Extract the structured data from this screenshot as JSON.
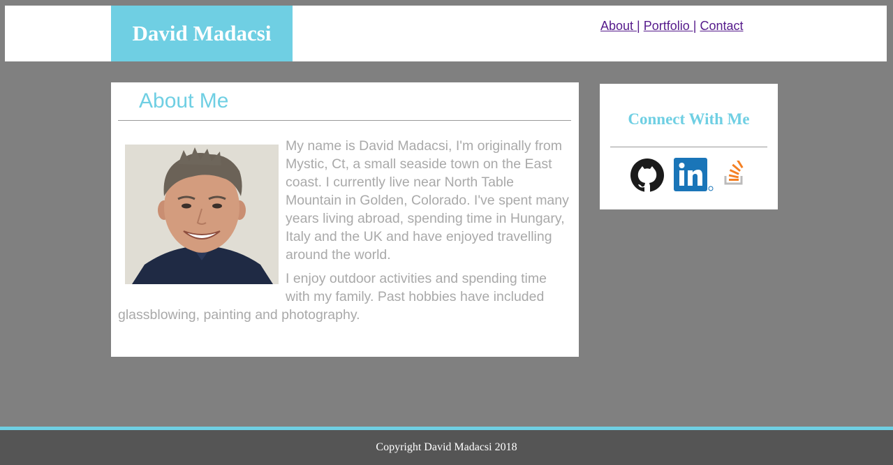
{
  "header": {
    "brand": "David Madacsi",
    "brand_color": "#6fcfe3",
    "nav": [
      {
        "label": "About |"
      },
      {
        "label": "Portfolio |"
      },
      {
        "label": "Contact"
      }
    ]
  },
  "about": {
    "title": "About Me",
    "photo_alt": "portrait-photo",
    "paragraphs": [
      "My name is David Madacsi, I'm originally from Mystic, Ct, a small seaside town on the East coast. I currently live near North Table Mountain in Golden, Colorado. I've spent many years living abroad, spending time in Hungary, Italy and the UK and have enjoyed travelling around the world.",
      "I enjoy outdoor activities and spending time with my family. Past hobbies have included glassblowing, painting and photography."
    ]
  },
  "connect": {
    "title": "Connect With Me",
    "icons": [
      "github-icon",
      "linkedin-icon",
      "stackoverflow-icon"
    ]
  },
  "footer": {
    "copyright": "Copyright David Madacsi 2018"
  },
  "colors": {
    "page_background": "#808080",
    "accent": "#6fcfe3",
    "footer_background": "#555555",
    "body_text": "#a9a9a9",
    "link": "#551a8b"
  }
}
